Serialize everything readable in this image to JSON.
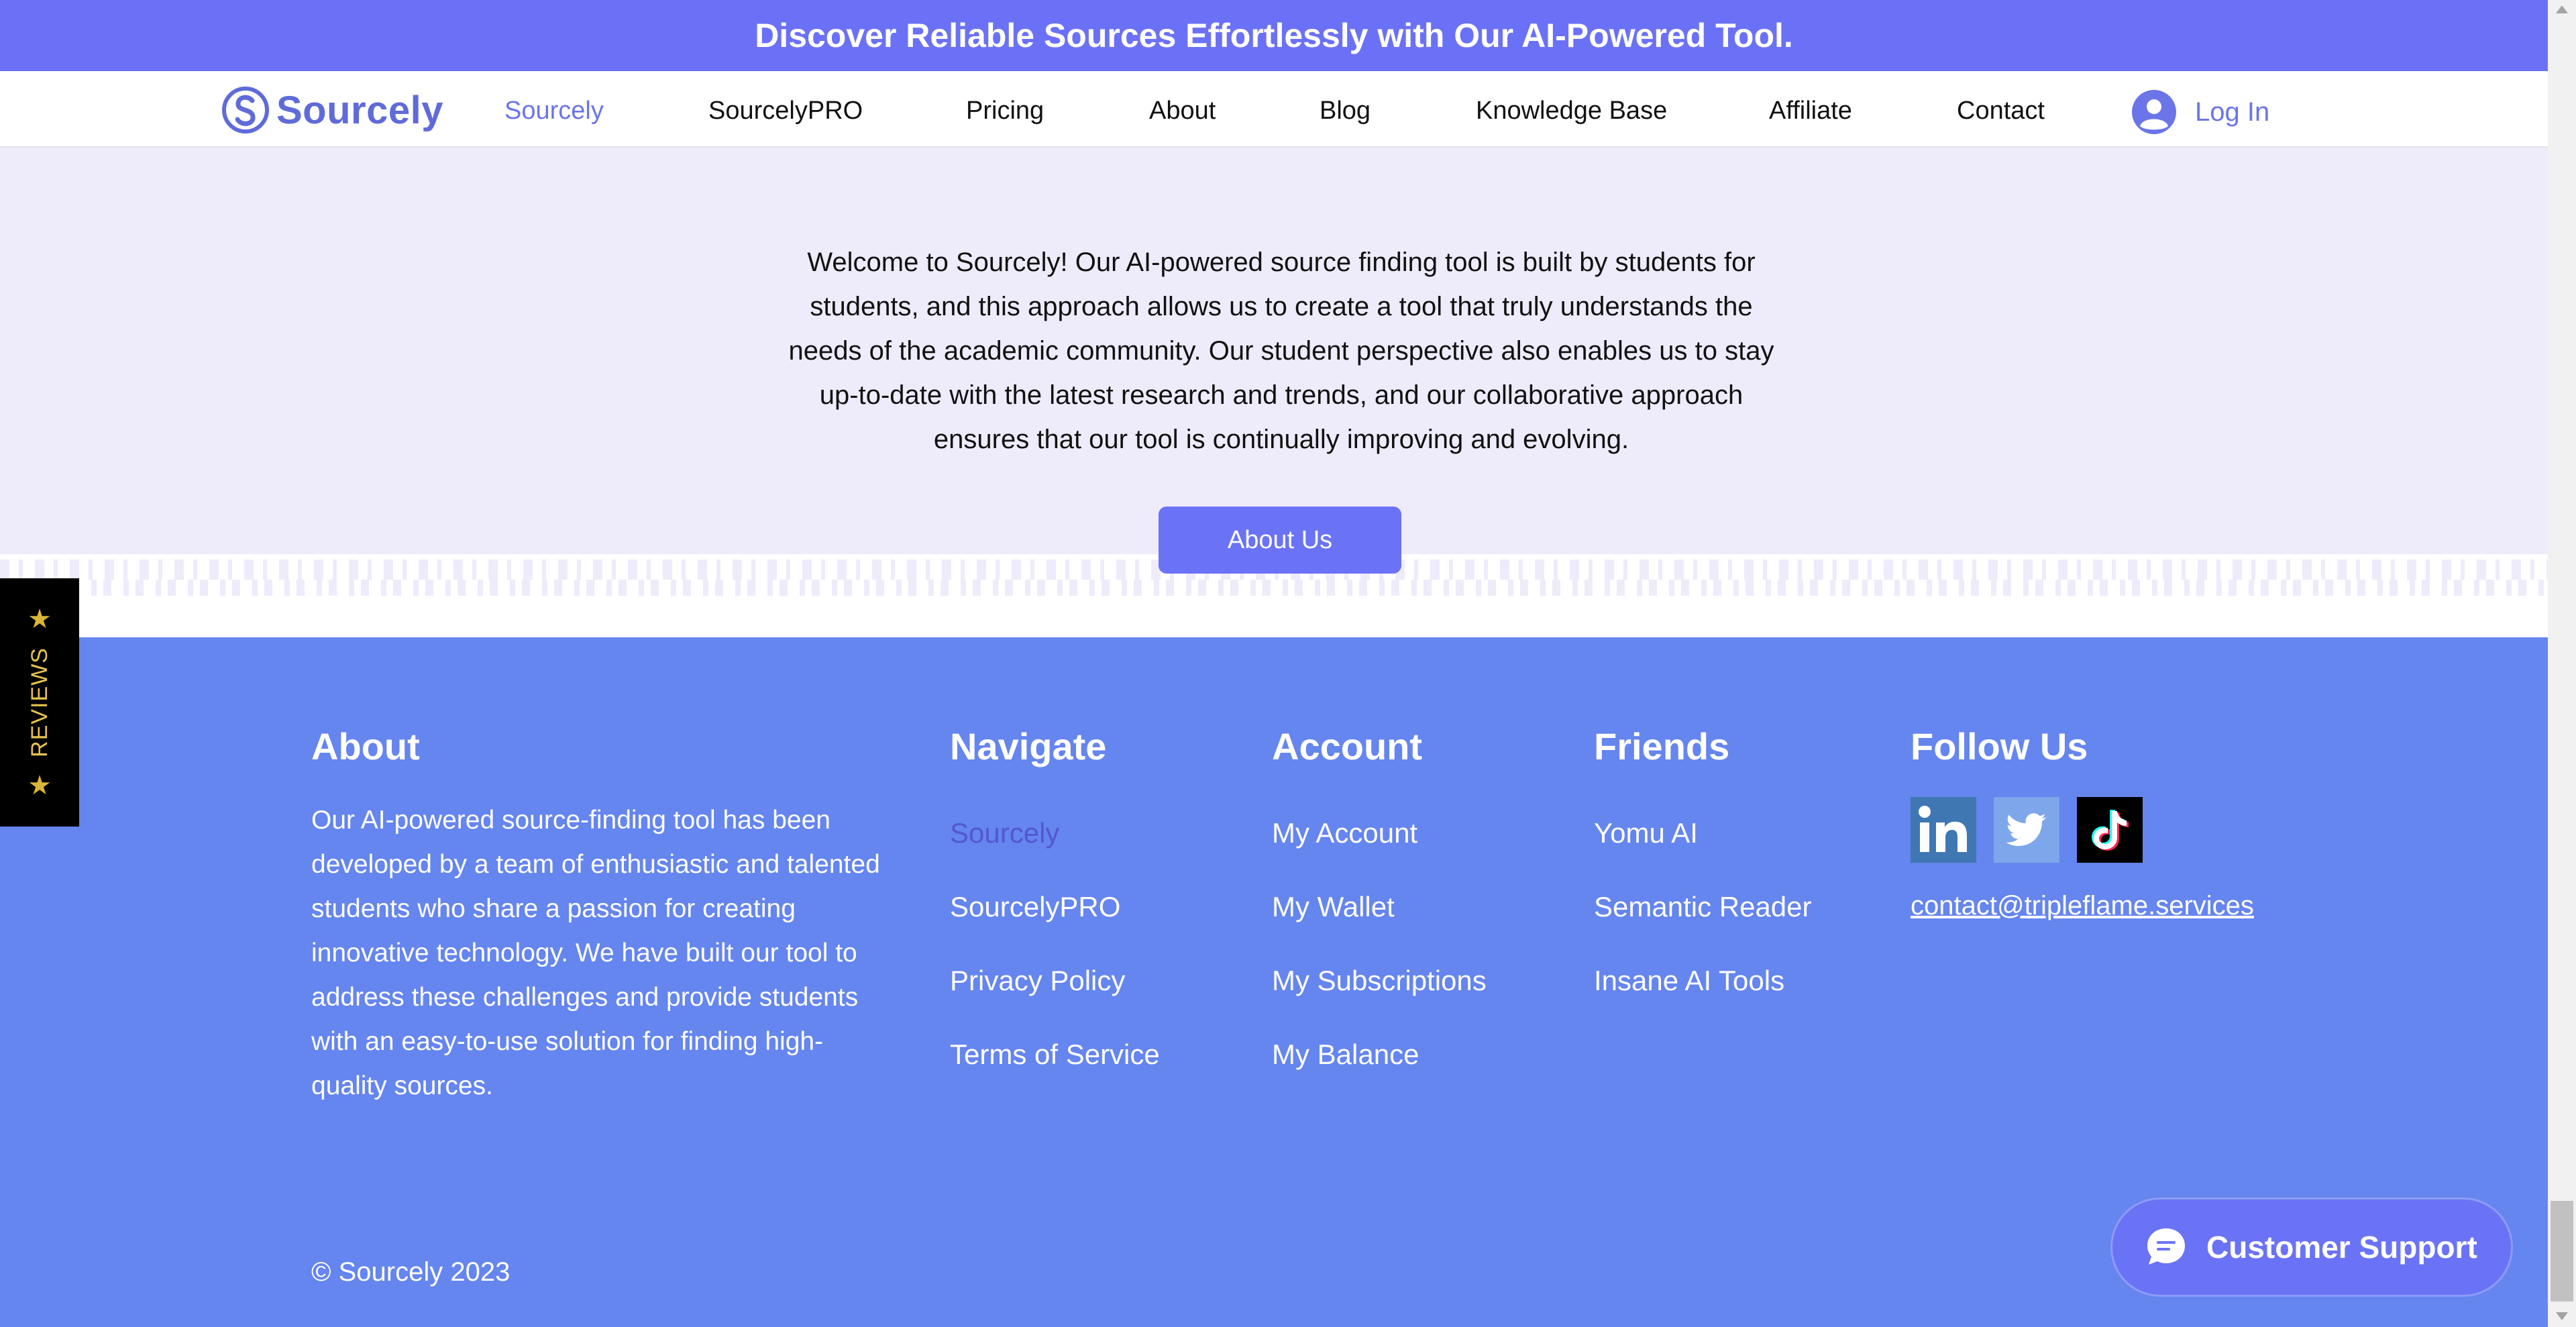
{
  "banner": {
    "text": "Discover Reliable Sources Effortlessly with Our AI-Powered Tool."
  },
  "header": {
    "logo_text": "Sourcely",
    "nav": [
      {
        "label": "Sourcely",
        "active": true
      },
      {
        "label": "SourcelyPRO"
      },
      {
        "label": "Pricing"
      },
      {
        "label": "About"
      },
      {
        "label": "Blog"
      },
      {
        "label": "Knowledge Base"
      },
      {
        "label": "Affiliate"
      },
      {
        "label": "Contact"
      }
    ],
    "login_label": "Log In",
    "login_icon": "user-circle-icon"
  },
  "hero": {
    "text": "Welcome to Sourcely! Our AI-powered source finding tool is built by students for students, and this approach allows us to create a tool that truly understands the needs of the academic community. Our student perspective also enables us to stay up-to-date with the latest research and trends, and our collaborative approach ensures that our tool is continually improving and evolving.",
    "button_label": "About Us"
  },
  "reviews_tab": {
    "label": "REVIEWS",
    "icon": "star-icon"
  },
  "footer": {
    "about": {
      "title": "About",
      "text": "Our AI-powered source-finding tool has been developed by a team of enthusiastic and talented students who share a passion for creating innovative technology. We have built our tool to address these challenges and provide students with an easy-to-use solution for finding high-quality sources."
    },
    "navigate": {
      "title": "Navigate",
      "links": [
        {
          "label": "Sourcely",
          "active": true
        },
        {
          "label": "SourcelyPRO"
        },
        {
          "label": "Privacy Policy"
        },
        {
          "label": "Terms of Service"
        }
      ]
    },
    "account": {
      "title": "Account",
      "links": [
        {
          "label": "My Account"
        },
        {
          "label": "My Wallet"
        },
        {
          "label": "My Subscriptions"
        },
        {
          "label": "My Balance"
        }
      ]
    },
    "friends": {
      "title": "Friends",
      "links": [
        {
          "label": "Yomu AI"
        },
        {
          "label": "Semantic Reader"
        },
        {
          "label": "Insane AI Tools"
        }
      ]
    },
    "follow": {
      "title": "Follow Us",
      "socials": [
        "linkedin-icon",
        "twitter-icon",
        "tiktok-icon"
      ],
      "email": "contact@tripleflame.services"
    },
    "copyright": "© Sourcely 2023"
  },
  "support": {
    "label": "Customer Support",
    "icon": "chat-bubble-icon"
  },
  "colors": {
    "primary": "#6b71f6",
    "footer_bg": "#6585ef",
    "hero_bg": "#eeecfb",
    "active_link": "#6b75e8"
  }
}
